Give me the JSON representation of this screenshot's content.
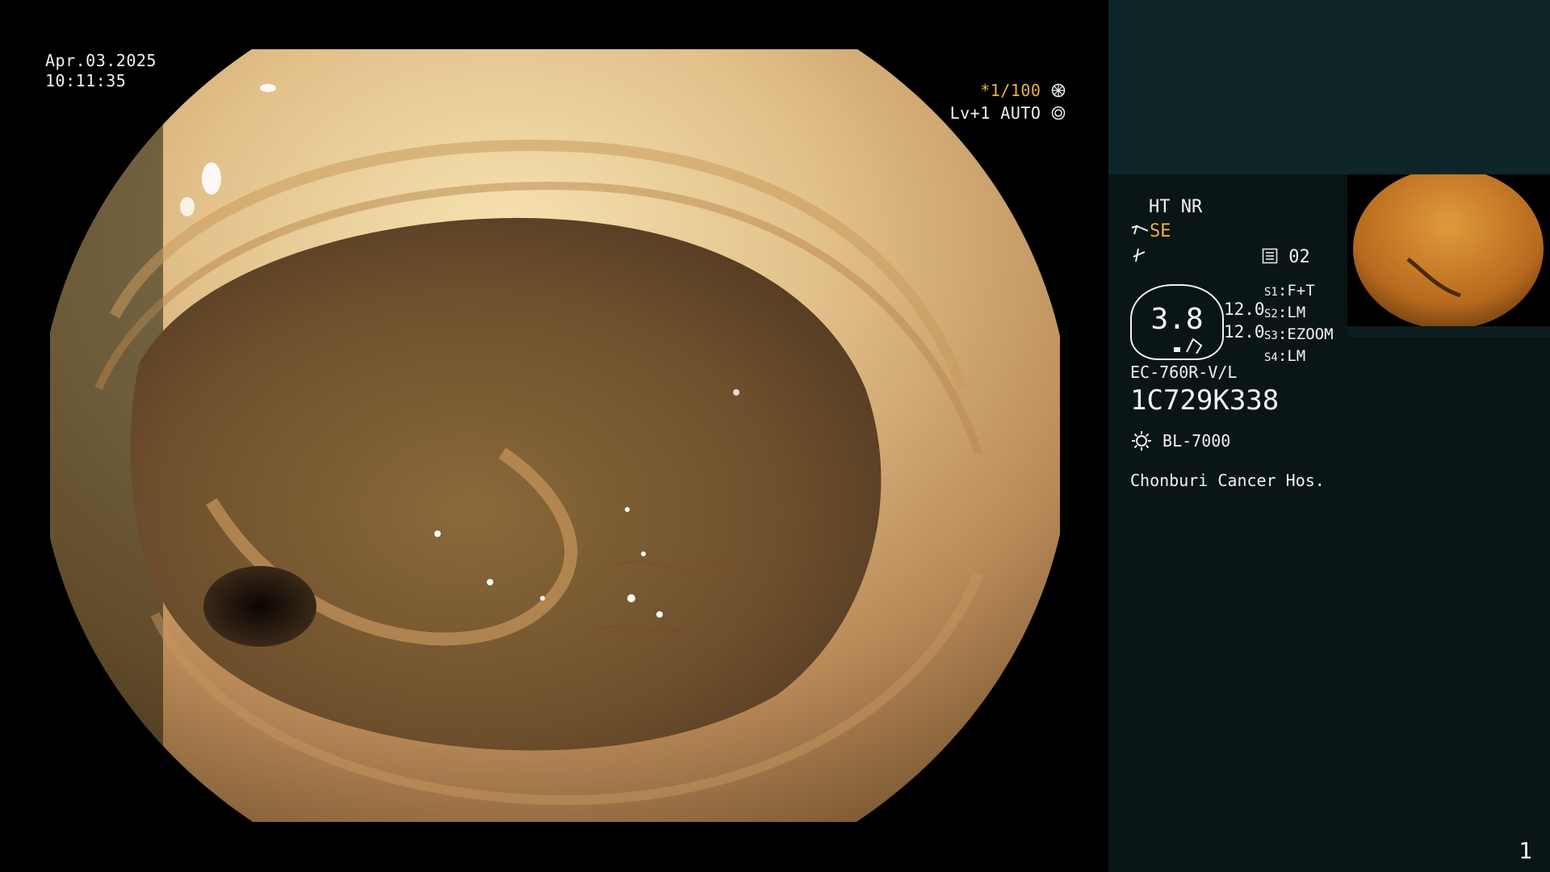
{
  "overlay": {
    "date": "Apr.03.2025",
    "time": "10:11:35",
    "shutter": "*1/100",
    "level_mode": "Lv+1 AUTO"
  },
  "side": {
    "ht_nr": "HT NR",
    "mode_icon": "scope-wave-icon",
    "mode_label": "SE",
    "tilde_icon": "f-slash-icon",
    "memo_icon": "memo-list-icon",
    "memo_value": "02",
    "dial_value": "3.8",
    "readings": [
      "12.0",
      "12.0"
    ],
    "switches": [
      {
        "key": "S1",
        "value": "F+T"
      },
      {
        "key": "S2",
        "value": "LM"
      },
      {
        "key": "S3",
        "value": "EZOOM"
      },
      {
        "key": "S4",
        "value": "LM"
      }
    ],
    "scope_model": "EC-760R-V/L",
    "scope_serial": "1C729K338",
    "light_icon": "light-source-sun-icon",
    "light_source": "BL-7000",
    "hospital": "Chonburi Cancer Hos.",
    "page": "1"
  },
  "colors": {
    "side_panel": "#0a1516",
    "side_top": "#0e2628",
    "accent": "#f0b040"
  }
}
